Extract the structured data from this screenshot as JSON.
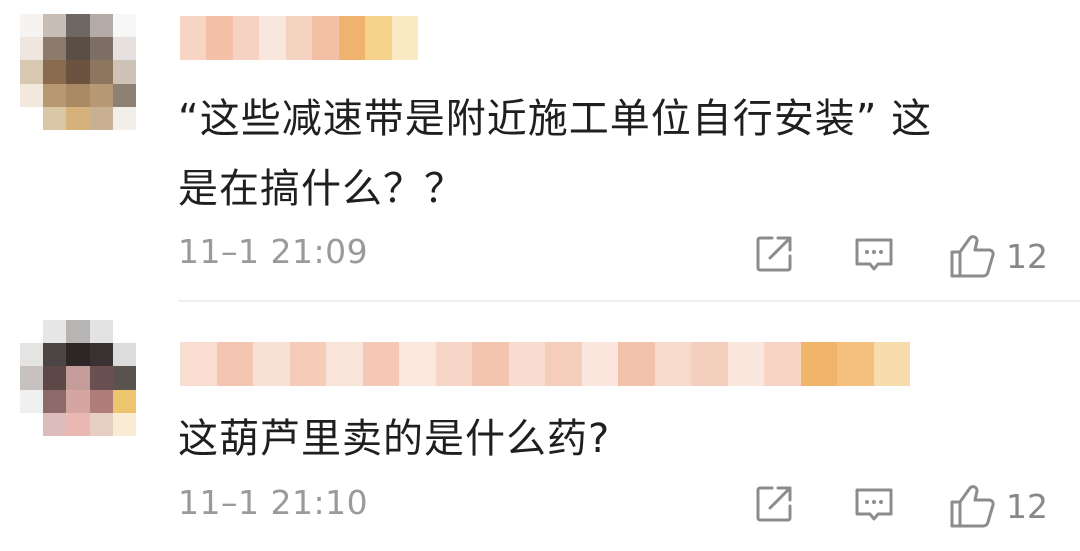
{
  "colors": {
    "text": "#1f1f1f",
    "meta": "#9a9a9a",
    "icon": "#8c8c8c",
    "divider": "#efefef"
  },
  "comments": [
    {
      "text_line1": "“这些减速带是附近施工单位自行安装” 这",
      "text_line2": "是在搞什么？？",
      "time": "11–1 21:09",
      "likes": "12",
      "icons": [
        "share-icon",
        "comment-icon",
        "thumbs-up-icon"
      ]
    },
    {
      "text_line1": "这葫芦里卖的是什么药?",
      "time": "11–1 21:10",
      "likes": "12",
      "icons": [
        "share-icon",
        "comment-icon",
        "thumbs-up-icon"
      ]
    }
  ]
}
